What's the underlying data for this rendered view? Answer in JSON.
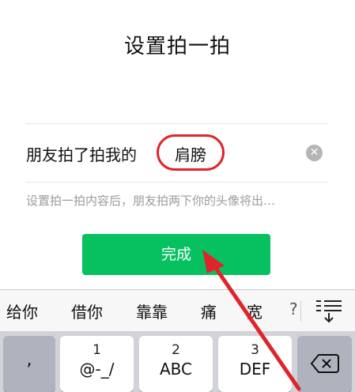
{
  "page": {
    "title": "设置拍一拍"
  },
  "row": {
    "label": "朋友拍了拍我的",
    "value": "肩膀",
    "clear_icon": "clear-icon"
  },
  "hint": "设置拍一拍内容后，朋友拍两下你的头像将出…",
  "done_button": {
    "label": "完成",
    "color": "#07c160"
  },
  "keyboard": {
    "candidates": [
      "给你",
      "借你",
      "靠靠",
      "痛",
      "宽",
      "?"
    ],
    "more_icon": "expand-candidates-icon",
    "keys": [
      {
        "number": "",
        "letters": ","
      },
      {
        "number": "1",
        "letters": "@-_/"
      },
      {
        "number": "2",
        "letters": "ABC"
      },
      {
        "number": "3",
        "letters": "DEF"
      }
    ],
    "delete_icon": "backspace-icon"
  },
  "annotation": {
    "arrow_color": "#e0242a",
    "circle_color": "#e0242a"
  }
}
